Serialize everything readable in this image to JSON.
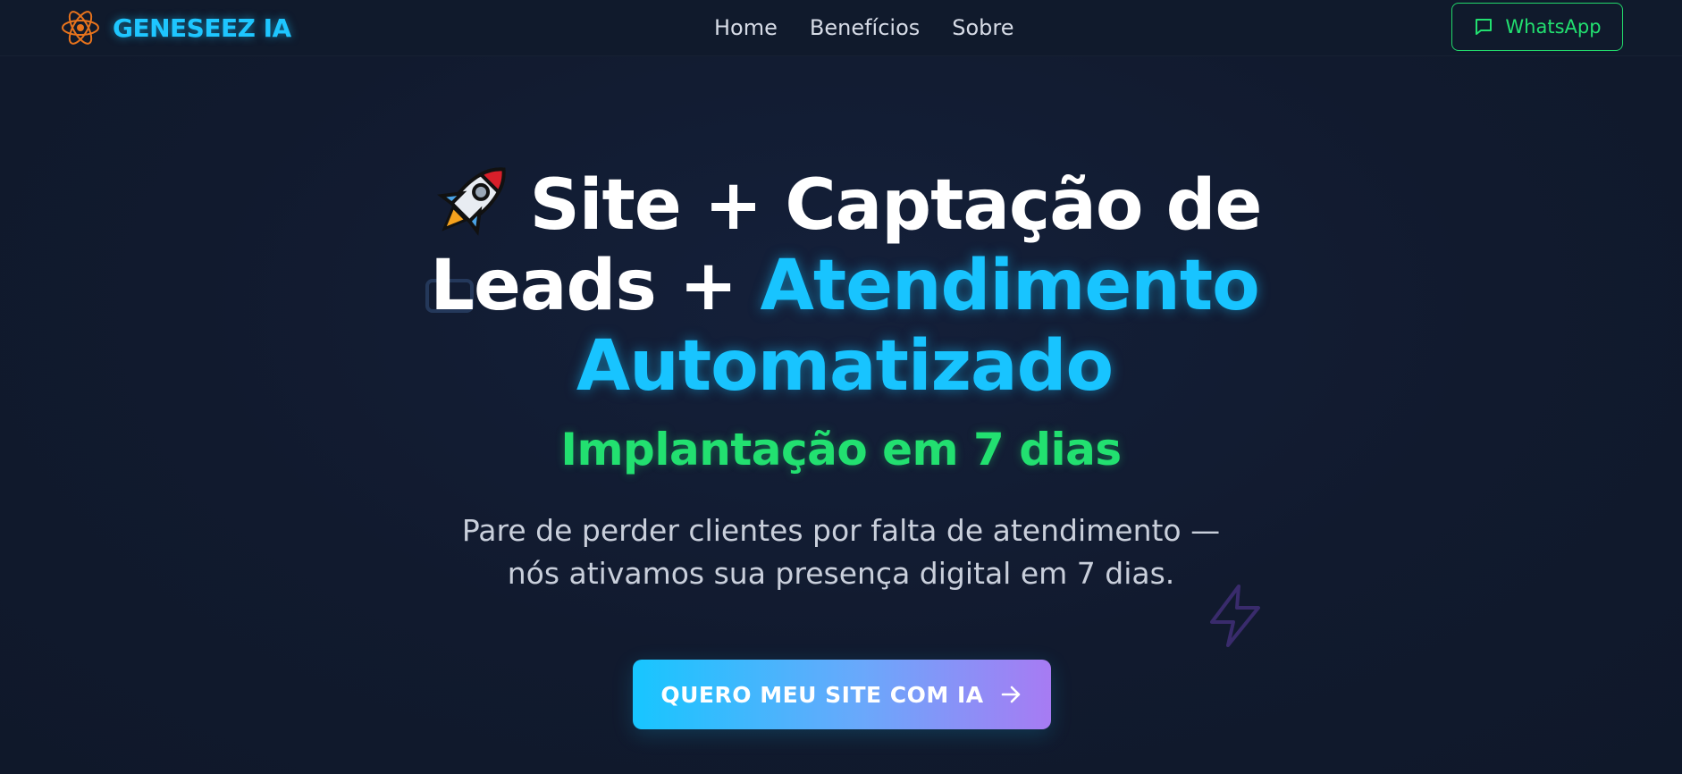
{
  "brand": {
    "name": "GENESEEZ IA",
    "logo_icon": "atom-icon",
    "accent_color": "#1ec6ff"
  },
  "nav": {
    "items": [
      {
        "label": "Home"
      },
      {
        "label": "Benefícios"
      },
      {
        "label": "Sobre"
      }
    ]
  },
  "header": {
    "whatsapp_label": "WhatsApp",
    "whatsapp_icon": "chat-bubble-icon",
    "whatsapp_color": "#22e070"
  },
  "hero": {
    "emoji_icon": "rocket-icon",
    "title_line1": "Site + Captação de",
    "title_line2_white": "Leads + ",
    "title_line2_accent": "Atendimento",
    "title_line3_accent": "Automatizado",
    "subtitle": "Implantação em 7 dias",
    "description_line1": "Pare de perder clientes por falta de atendimento —",
    "description_line2": "nós ativamos sua presença digital em 7 dias.",
    "cta_label": "QUERO MEU SITE COM IA",
    "cta_icon": "arrow-right-icon",
    "title_accent_color": "#18c4ff",
    "subtitle_color": "#22e070",
    "cta_gradient": [
      "#17c6ff",
      "#a77bf3"
    ]
  },
  "decorations": {
    "ghost_icons": [
      "chat-bubble-icon",
      "lightning-icon"
    ]
  }
}
